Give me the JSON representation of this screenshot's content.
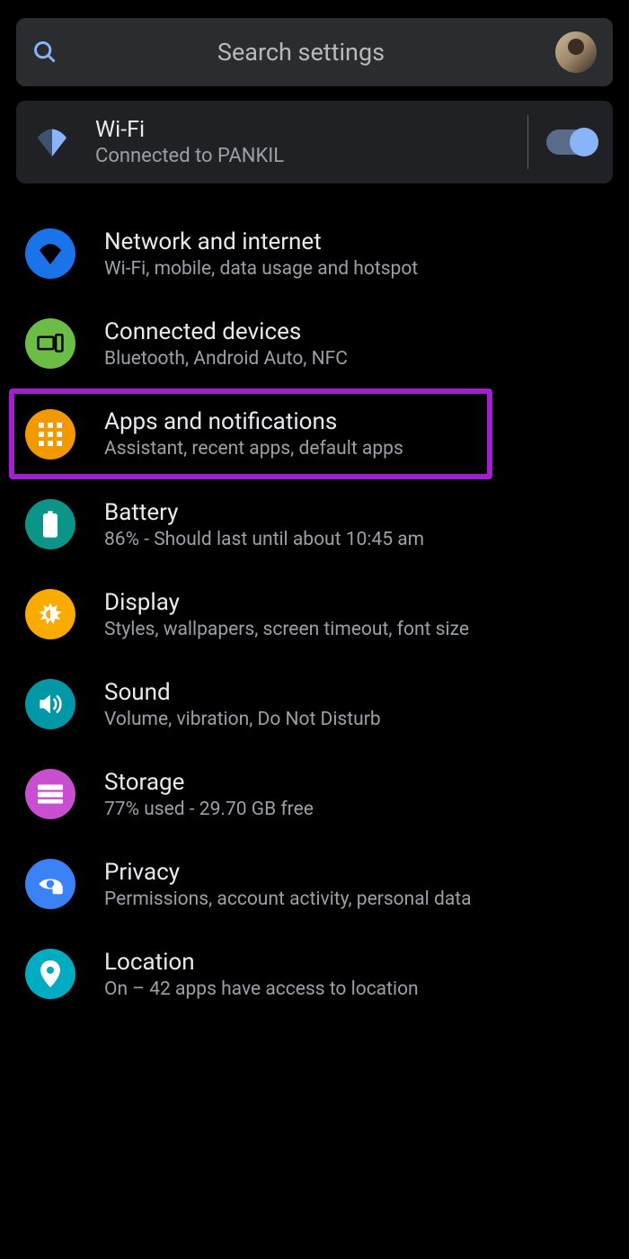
{
  "search": {
    "placeholder": "Search settings"
  },
  "quick": {
    "title": "Wi-Fi",
    "subtitle": "Connected to PANKIL"
  },
  "items": [
    {
      "title": "Network and internet",
      "subtitle": "Wi-Fi, mobile, data usage and hotspot"
    },
    {
      "title": "Connected devices",
      "subtitle": "Bluetooth, Android Auto, NFC"
    },
    {
      "title": "Apps and notifications",
      "subtitle": "Assistant, recent apps, default apps"
    },
    {
      "title": "Battery",
      "subtitle": "86% - Should last until about 10:45 am"
    },
    {
      "title": "Display",
      "subtitle": "Styles, wallpapers, screen timeout, font size"
    },
    {
      "title": "Sound",
      "subtitle": "Volume, vibration, Do Not Disturb"
    },
    {
      "title": "Storage",
      "subtitle": "77% used - 29.70 GB free"
    },
    {
      "title": "Privacy",
      "subtitle": "Permissions, account activity, personal data"
    },
    {
      "title": "Location",
      "subtitle": "On – 42 apps have access to location"
    }
  ]
}
